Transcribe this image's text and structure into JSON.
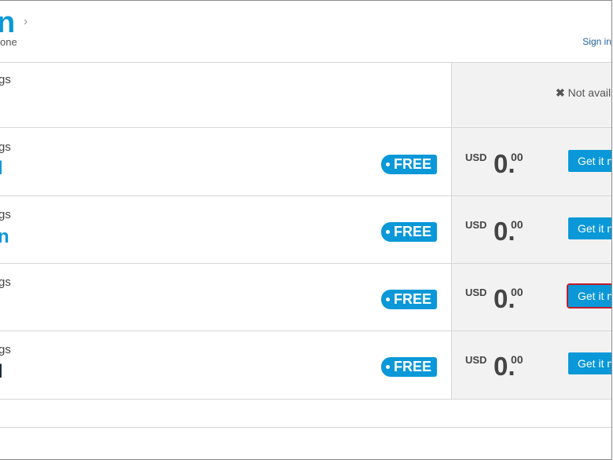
{
  "header": {
    "logo_text": "n",
    "breadcrumb_chevron": "›",
    "logo_subtitle": "one",
    "sign_in": "Sign in"
  },
  "top_row": {
    "label": "gs",
    "not_available": "Not availa",
    "not_available_icon": "close-icon"
  },
  "rows": [
    {
      "label": "gs",
      "mark": "l",
      "badge": "FREE",
      "currency": "USD",
      "price_int": "0.",
      "price_dec": "00",
      "button": "Get it no"
    },
    {
      "label": "gs",
      "mark": "n",
      "badge": "FREE",
      "currency": "USD",
      "price_int": "0.",
      "price_dec": "00",
      "button": "Get it no"
    },
    {
      "label": "gs",
      "mark": "",
      "badge": "FREE",
      "currency": "USD",
      "price_int": "0.",
      "price_dec": "00",
      "button": "Get it no"
    },
    {
      "label": "gs",
      "mark": "l",
      "badge": "FREE",
      "currency": "USD",
      "price_int": "0.",
      "price_dec": "00",
      "button": "Get it no"
    }
  ],
  "colors": {
    "accent": "#0a98d8",
    "focus_outline": "#c21c2c",
    "panel_bg": "#f2f2f2"
  }
}
